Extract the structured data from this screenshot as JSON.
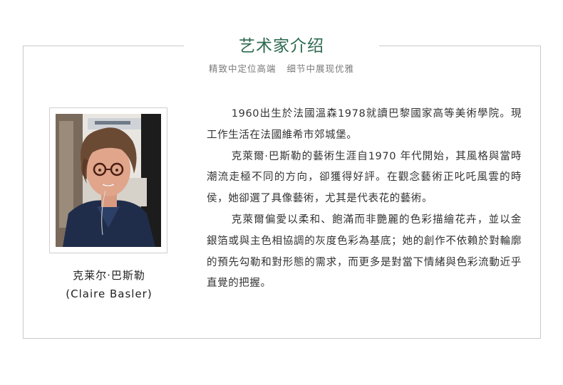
{
  "header": {
    "title": "艺术家介绍",
    "subtitle": "精致中定位高端   细节中展现优雅"
  },
  "artist": {
    "name_cn": "克莱尔·巴斯勒",
    "name_latin": "(Claire Basler)",
    "photo_icon": "portrait-photo"
  },
  "bio": {
    "paragraphs": [
      "1960出生於法國溫森1978就讀巴黎國家高等美術學院。現工作生活在法國維希市郊城堡。",
      "克萊爾·巴斯勒的藝術生涯自1970 年代開始，其風格與當時潮流走極不同的方向，卻獲得好評。在觀念藝術正叱吒風雲的時侯，她卻選了具像藝術，尤其是代表花的藝術。",
      "克萊爾偏愛以柔和、飽滿而非艷麗的色彩描繪花卉，並以金銀箔或與主色相協調的灰度色彩為基底；她的創作不依賴於對輪廓的預先勾勒和對形態的需求，而更多是對當下情緒與色彩流動近乎直覺的把握。"
    ]
  },
  "colors": {
    "title": "#2d6a4f",
    "frame_border": "#c9c9c9",
    "subtitle": "#7a7a7a"
  }
}
